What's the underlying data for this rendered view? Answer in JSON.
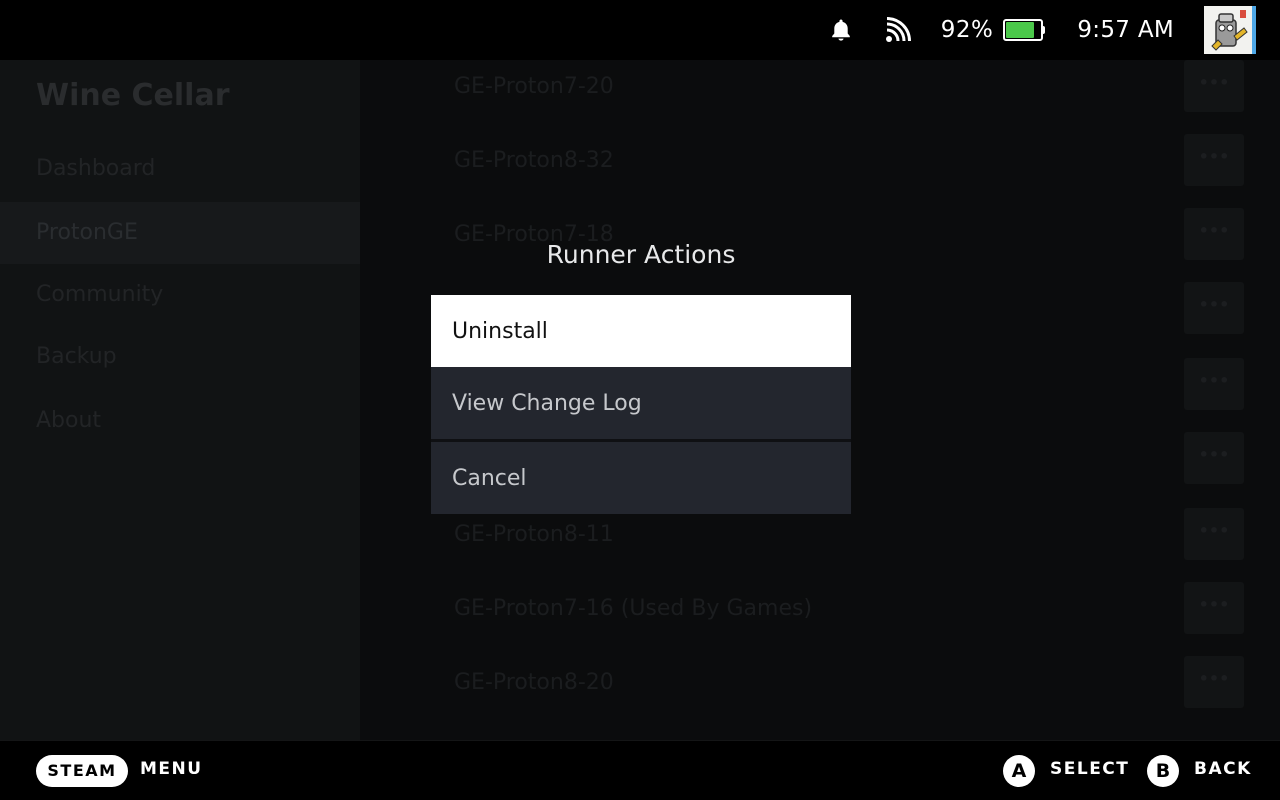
{
  "status_bar": {
    "notification_icon": "bell-icon",
    "connection_icon": "wifi-icon",
    "battery_percent": "92%",
    "battery_level": 0.92,
    "battery_color": "#4bc84a",
    "clock": "9:57 AM",
    "avatar_icon": "avatar-image"
  },
  "background": {
    "app_title": "Wine Cellar",
    "nav_items": [
      "Dashboard",
      "ProtonGE",
      "Community",
      "Backup",
      "About"
    ],
    "active_nav": "ProtonGE",
    "runner_rows": [
      "GE-Proton7-20",
      "GE-Proton8-32",
      "GE-Proton7-18",
      "",
      "",
      "",
      "GE-Proton8-11",
      "GE-Proton7-16 (Used By Games)",
      "GE-Proton8-20"
    ],
    "row_button_label": "•••"
  },
  "modal": {
    "title": "Runner Actions",
    "items": [
      "Uninstall",
      "View Change Log",
      "Cancel"
    ],
    "focused_index": 0
  },
  "footer": {
    "steam_label": "STEAM",
    "menu_label": "MENU",
    "a_button": "A",
    "select_label": "SELECT",
    "b_button": "B",
    "back_label": "BACK"
  }
}
